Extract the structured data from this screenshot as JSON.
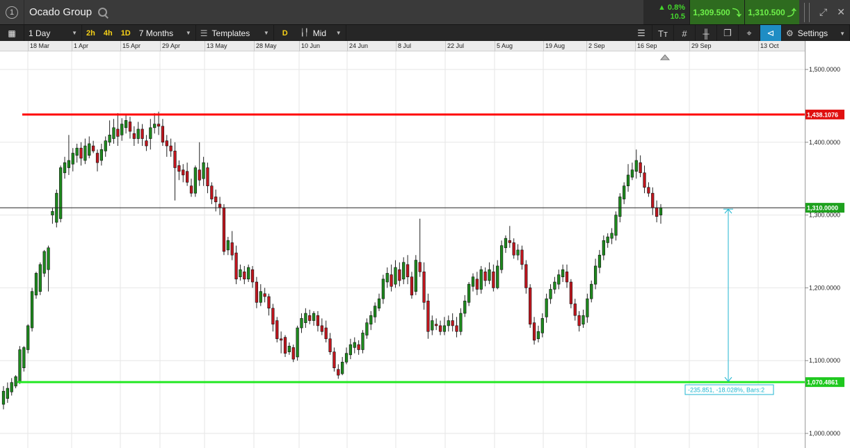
{
  "window": {
    "number": "1",
    "instrument": "Ocado Group",
    "change_pct": "▲ 0.8%",
    "change_abs": "10.5",
    "sell_price": "1,309.500",
    "buy_price": "1,310.500"
  },
  "toolbar": {
    "interval": "1 Day",
    "quick_intervals": [
      "2h",
      "4h",
      "1D"
    ],
    "range": "7 Months",
    "templates": "Templates",
    "drawing_toggle": "D",
    "price_type": "Mid",
    "settings": "Settings",
    "right_icons": [
      "indicator-icon",
      "text-icon",
      "grid-icon",
      "candle-type-icon",
      "layers-icon",
      "tool-icon",
      "tag-icon",
      "settings-gear-icon"
    ]
  },
  "date_axis": {
    "labels": [
      "18 Mar",
      "1 Apr",
      "15 Apr",
      "29 Apr",
      "13 May",
      "28 May",
      "10 Jun",
      "24 Jun",
      "8 Jul",
      "22 Jul",
      "5 Aug",
      "19 Aug",
      "2 Sep",
      "16 Sep",
      "29 Sep",
      "13 Oct"
    ]
  },
  "price_axis": {
    "ticks": [
      "1,500.0000",
      "1,400.0000",
      "1,300.0000",
      "1,200.0000",
      "1,100.0000",
      "1,000.0000"
    ]
  },
  "colors": {
    "up": "#1e8a1e",
    "down": "#c0161e",
    "resistance": "#ff0000",
    "support": "#22e822",
    "measure": "#1fb6d0",
    "current_price": "#1ea11e"
  },
  "lines": {
    "resistance_label": "1,438.1076",
    "support_label": "1,070.4861",
    "current_label": "1,310.0000",
    "measure_label": "-235.851, -18.028%, Bars:2"
  },
  "chart_data": {
    "type": "candlestick",
    "xlabel": "",
    "ylabel": "",
    "ylim": [
      980,
      1520
    ],
    "resistance": 1438.1076,
    "support": 1070.4861,
    "current": 1310.0,
    "candles": [
      [
        1040,
        1058,
        1033,
        1065
      ],
      [
        1048,
        1062,
        1042,
        1070
      ],
      [
        1057,
        1070,
        1052,
        1076
      ],
      [
        1065,
        1078,
        1062,
        1080
      ],
      [
        1070,
        1115,
        1068,
        1120
      ],
      [
        1090,
        1118,
        1085,
        1120
      ],
      [
        1115,
        1148,
        1110,
        1150
      ],
      [
        1145,
        1195,
        1140,
        1200
      ],
      [
        1190,
        1220,
        1185,
        1222
      ],
      [
        1195,
        1232,
        1190,
        1235
      ],
      [
        1220,
        1250,
        1215,
        1252
      ],
      [
        1225,
        1255,
        1195,
        1258
      ],
      [
        1300,
        1305,
        1288,
        1310
      ],
      [
        1290,
        1330,
        1283,
        1335
      ],
      [
        1295,
        1365,
        1290,
        1368
      ],
      [
        1358,
        1372,
        1350,
        1380
      ],
      [
        1365,
        1375,
        1355,
        1410
      ],
      [
        1370,
        1385,
        1360,
        1392
      ],
      [
        1382,
        1392,
        1372,
        1398
      ],
      [
        1392,
        1378,
        1368,
        1400
      ],
      [
        1375,
        1395,
        1370,
        1405
      ],
      [
        1382,
        1398,
        1378,
        1408
      ],
      [
        1395,
        1388,
        1385,
        1402
      ],
      [
        1385,
        1372,
        1360,
        1390
      ],
      [
        1375,
        1390,
        1368,
        1398
      ],
      [
        1388,
        1402,
        1380,
        1408
      ],
      [
        1400,
        1410,
        1395,
        1430
      ],
      [
        1405,
        1420,
        1398,
        1432
      ],
      [
        1418,
        1408,
        1395,
        1440
      ],
      [
        1410,
        1425,
        1402,
        1433
      ],
      [
        1420,
        1430,
        1412,
        1438
      ],
      [
        1428,
        1415,
        1405,
        1435
      ],
      [
        1412,
        1405,
        1395,
        1422
      ],
      [
        1405,
        1418,
        1398,
        1428
      ],
      [
        1418,
        1405,
        1395,
        1425
      ],
      [
        1402,
        1395,
        1388,
        1410
      ],
      [
        1405,
        1420,
        1390,
        1432
      ],
      [
        1420,
        1425,
        1412,
        1440
      ],
      [
        1425,
        1422,
        1410,
        1442
      ],
      [
        1422,
        1400,
        1395,
        1432
      ],
      [
        1402,
        1395,
        1380,
        1410
      ],
      [
        1395,
        1388,
        1380,
        1405
      ],
      [
        1388,
        1365,
        1320,
        1400
      ],
      [
        1368,
        1360,
        1348,
        1375
      ],
      [
        1362,
        1355,
        1345,
        1370
      ],
      [
        1360,
        1345,
        1340,
        1372
      ],
      [
        1340,
        1330,
        1325,
        1350
      ],
      [
        1330,
        1365,
        1325,
        1368
      ],
      [
        1362,
        1348,
        1340,
        1400
      ],
      [
        1350,
        1372,
        1340,
        1380
      ],
      [
        1365,
        1340,
        1330,
        1372
      ],
      [
        1340,
        1322,
        1315,
        1345
      ],
      [
        1325,
        1318,
        1305,
        1335
      ],
      [
        1315,
        1310,
        1300,
        1325
      ],
      [
        1310,
        1250,
        1245,
        1315
      ],
      [
        1252,
        1265,
        1245,
        1270
      ],
      [
        1262,
        1245,
        1238,
        1278
      ],
      [
        1248,
        1212,
        1205,
        1258
      ],
      [
        1215,
        1225,
        1210,
        1232
      ],
      [
        1222,
        1212,
        1205,
        1230
      ],
      [
        1212,
        1228,
        1208,
        1232
      ],
      [
        1225,
        1208,
        1200,
        1230
      ],
      [
        1208,
        1180,
        1172,
        1215
      ],
      [
        1180,
        1195,
        1175,
        1205
      ],
      [
        1192,
        1188,
        1180,
        1200
      ],
      [
        1188,
        1172,
        1162,
        1192
      ],
      [
        1172,
        1150,
        1140,
        1178
      ],
      [
        1155,
        1130,
        1125,
        1160
      ],
      [
        1130,
        1128,
        1110,
        1140
      ],
      [
        1132,
        1110,
        1105,
        1135
      ],
      [
        1112,
        1120,
        1108,
        1125
      ],
      [
        1118,
        1102,
        1098,
        1122
      ],
      [
        1105,
        1145,
        1100,
        1148
      ],
      [
        1145,
        1158,
        1138,
        1165
      ],
      [
        1152,
        1165,
        1145,
        1172
      ],
      [
        1162,
        1155,
        1150,
        1170
      ],
      [
        1155,
        1165,
        1148,
        1168
      ],
      [
        1162,
        1148,
        1140,
        1168
      ],
      [
        1148,
        1140,
        1135,
        1158
      ],
      [
        1145,
        1130,
        1125,
        1155
      ],
      [
        1130,
        1112,
        1108,
        1138
      ],
      [
        1112,
        1090,
        1085,
        1118
      ],
      [
        1088,
        1080,
        1075,
        1095
      ],
      [
        1082,
        1098,
        1080,
        1105
      ],
      [
        1098,
        1110,
        1095,
        1118
      ],
      [
        1108,
        1122,
        1102,
        1130
      ],
      [
        1118,
        1125,
        1110,
        1132
      ],
      [
        1122,
        1115,
        1108,
        1128
      ],
      [
        1115,
        1138,
        1110,
        1142
      ],
      [
        1135,
        1152,
        1130,
        1158
      ],
      [
        1150,
        1162,
        1142,
        1168
      ],
      [
        1160,
        1175,
        1152,
        1180
      ],
      [
        1172,
        1185,
        1168,
        1192
      ],
      [
        1185,
        1212,
        1178,
        1218
      ],
      [
        1208,
        1220,
        1200,
        1228
      ],
      [
        1218,
        1202,
        1195,
        1232
      ],
      [
        1205,
        1228,
        1200,
        1238
      ],
      [
        1225,
        1210,
        1202,
        1235
      ],
      [
        1212,
        1235,
        1205,
        1242
      ],
      [
        1232,
        1215,
        1205,
        1245
      ],
      [
        1215,
        1190,
        1185,
        1222
      ],
      [
        1195,
        1238,
        1190,
        1245
      ],
      [
        1235,
        1222,
        1215,
        1295
      ],
      [
        1222,
        1180,
        1170,
        1235
      ],
      [
        1182,
        1140,
        1130,
        1192
      ],
      [
        1142,
        1155,
        1135,
        1162
      ],
      [
        1150,
        1148,
        1142,
        1158
      ],
      [
        1148,
        1140,
        1135,
        1155
      ],
      [
        1140,
        1148,
        1135,
        1160
      ],
      [
        1148,
        1155,
        1140,
        1162
      ],
      [
        1155,
        1148,
        1140,
        1165
      ],
      [
        1148,
        1140,
        1132,
        1160
      ],
      [
        1140,
        1165,
        1135,
        1172
      ],
      [
        1165,
        1182,
        1160,
        1190
      ],
      [
        1180,
        1205,
        1175,
        1208
      ],
      [
        1202,
        1215,
        1195,
        1220
      ],
      [
        1212,
        1198,
        1190,
        1222
      ],
      [
        1198,
        1225,
        1192,
        1230
      ],
      [
        1222,
        1210,
        1202,
        1228
      ],
      [
        1210,
        1225,
        1205,
        1235
      ],
      [
        1222,
        1200,
        1195,
        1232
      ],
      [
        1200,
        1230,
        1198,
        1238
      ],
      [
        1225,
        1258,
        1220,
        1265
      ],
      [
        1255,
        1268,
        1248,
        1272
      ],
      [
        1265,
        1262,
        1255,
        1285
      ],
      [
        1262,
        1245,
        1240,
        1268
      ],
      [
        1245,
        1252,
        1238,
        1260
      ],
      [
        1252,
        1232,
        1225,
        1258
      ],
      [
        1232,
        1200,
        1192,
        1238
      ],
      [
        1200,
        1150,
        1145,
        1205
      ],
      [
        1152,
        1128,
        1122,
        1160
      ],
      [
        1130,
        1140,
        1125,
        1148
      ],
      [
        1138,
        1158,
        1132,
        1165
      ],
      [
        1160,
        1185,
        1152,
        1192
      ],
      [
        1185,
        1198,
        1178,
        1205
      ],
      [
        1198,
        1208,
        1192,
        1215
      ],
      [
        1205,
        1218,
        1198,
        1225
      ],
      [
        1215,
        1225,
        1208,
        1232
      ],
      [
        1222,
        1208,
        1200,
        1232
      ],
      [
        1208,
        1178,
        1172,
        1212
      ],
      [
        1178,
        1162,
        1155,
        1185
      ],
      [
        1162,
        1148,
        1140,
        1168
      ],
      [
        1150,
        1162,
        1145,
        1170
      ],
      [
        1160,
        1185,
        1152,
        1192
      ],
      [
        1185,
        1205,
        1180,
        1210
      ],
      [
        1205,
        1230,
        1198,
        1240
      ],
      [
        1228,
        1245,
        1220,
        1252
      ],
      [
        1245,
        1265,
        1238,
        1272
      ],
      [
        1262,
        1270,
        1255,
        1275
      ],
      [
        1268,
        1275,
        1260,
        1282
      ],
      [
        1272,
        1300,
        1265,
        1305
      ],
      [
        1298,
        1325,
        1290,
        1330
      ],
      [
        1322,
        1340,
        1315,
        1345
      ],
      [
        1340,
        1355,
        1332,
        1370
      ],
      [
        1352,
        1362,
        1348,
        1372
      ],
      [
        1360,
        1375,
        1350,
        1390
      ],
      [
        1372,
        1358,
        1352,
        1382
      ],
      [
        1358,
        1338,
        1330,
        1368
      ],
      [
        1338,
        1330,
        1325,
        1345
      ],
      [
        1330,
        1310,
        1300,
        1338
      ],
      [
        1310,
        1298,
        1290,
        1320
      ],
      [
        1300,
        1310,
        1288,
        1315
      ]
    ]
  }
}
